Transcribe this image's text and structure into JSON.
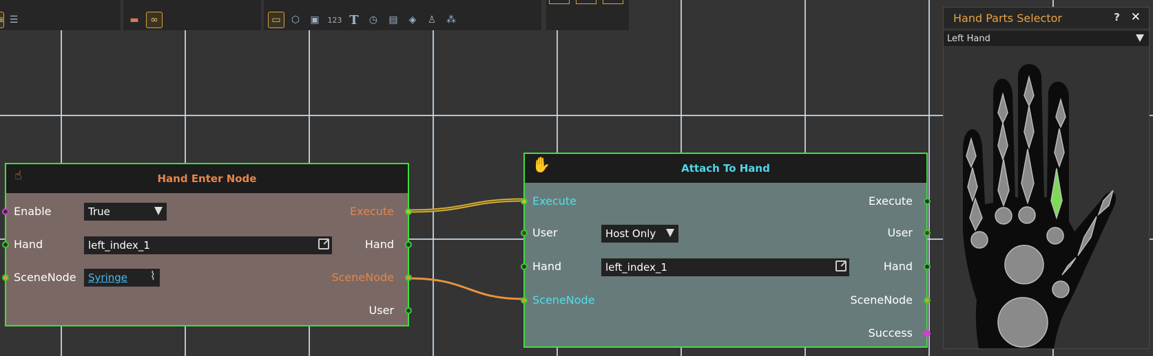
{
  "toolbar": {
    "icons_group3": [
      "card-icon",
      "cube-icon",
      "clapper-icon",
      "number-icon",
      "text-icon",
      "timer-icon",
      "display-icon",
      "tag-icon",
      "person-icon",
      "network-icon"
    ],
    "number_label": "123",
    "text_label": "T"
  },
  "hand_enter_node": {
    "title": "Hand Enter Node",
    "inputs": [
      "Enable",
      "Hand",
      "SceneNode"
    ],
    "outputs": [
      "Execute",
      "Hand",
      "SceneNode",
      "User"
    ],
    "enable_value": "True",
    "hand_value": "left_index_1",
    "scenenode_value": "Syringe"
  },
  "attach_to_hand": {
    "title": "Attach To Hand",
    "inputs": [
      "Execute",
      "User",
      "Hand",
      "SceneNode"
    ],
    "outputs": [
      "Execute",
      "User",
      "Hand",
      "SceneNode",
      "Success"
    ],
    "user_value": "Host Only",
    "hand_value": "left_index_1"
  },
  "hand_parts_selector": {
    "title": "Hand Parts Selector",
    "help_label": "?",
    "close_label": "✕",
    "selected": "Left Hand"
  },
  "colors": {
    "node_border": "#3ee03e",
    "hand_enter_title": "#e8844a",
    "attach_title": "#4fd6e8",
    "wire_exec": "#d9b43a",
    "wire_scene": "#e8943a",
    "selected_part": "#7ed957"
  }
}
